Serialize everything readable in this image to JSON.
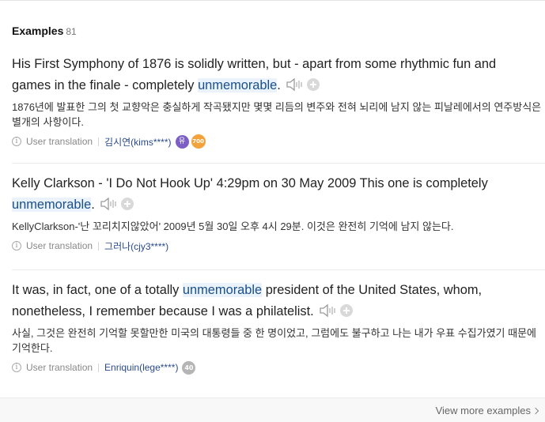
{
  "section": {
    "title": "Examples",
    "count": "81"
  },
  "examples": [
    {
      "en_before": "His First Symphony of 1876 is solidly written, but - apart from some rhythmic fun and games in the finale - completely ",
      "en_highlight": "unmemorable",
      "en_after": ".",
      "ko": "1876년에 발표한 그의 첫 교향악은 충실하게 작곡됐지만 몇몇 리듬의 변주와 전혀 뇌리에 남지 않는 피날레에서의 연주방식은 별개의 사항이다.",
      "source": "User translation",
      "user": "김시연(kims****)",
      "badges": [
        "유",
        "700"
      ]
    },
    {
      "en_before": "Kelly Clarkson - 'I Do Not Hook Up' 4:29pm on 30 May 2009 This one is completely ",
      "en_highlight": "unmemorable",
      "en_after": ".",
      "ko": "KellyClarkson-'난 꼬리치지않았어' 2009년 5월 30일 오후 4시 29분. 이것은 완전히 기억에 남지 않는다.",
      "source": "User translation",
      "user": "그러나(cjy3****)",
      "badges": []
    },
    {
      "en_before": "It was, in fact, one of a totally ",
      "en_highlight": "unmemorable",
      "en_after": " president of the United States, whom, nonetheless, I remember because I was a philatelist.",
      "ko": "사실, 그것은 완전히 기억할 못할만한 미국의 대통령들 중 한 명이었고, 그럼에도 불구하고 나는 내가 우표 수집가였기 때문에 기억한다.",
      "source": "User translation",
      "user": "Enriquin(lege****)",
      "badges": [
        "40"
      ]
    }
  ],
  "footer": {
    "view_more": "View more examples"
  },
  "colors": {
    "highlight_bg": "#eaf3fb",
    "highlight_text": "#1a4f8a",
    "user_link": "#2a4a8a",
    "badge_purple": "#7b5fc4",
    "badge_orange": "#f2a33c",
    "badge_gray": "#b5b5b5"
  }
}
